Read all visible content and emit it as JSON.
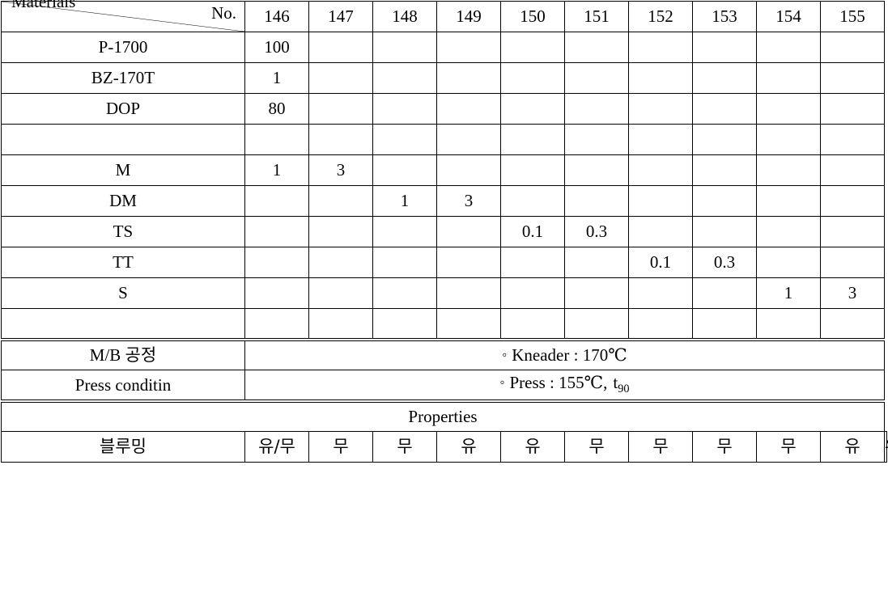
{
  "table": {
    "header": {
      "no_label": "No.",
      "materials_label": "Materials",
      "columns": [
        "146",
        "147",
        "148",
        "149",
        "150",
        "151",
        "152",
        "153",
        "154",
        "155"
      ]
    },
    "material_rows": [
      {
        "label": "P-1700",
        "values": [
          "100",
          "",
          "",
          "",
          "",
          "",
          "",
          "",
          "",
          ""
        ]
      },
      {
        "label": "BZ-170T",
        "values": [
          "1",
          "",
          "",
          "",
          "",
          "",
          "",
          "",
          "",
          ""
        ]
      },
      {
        "label": "DOP",
        "values": [
          "80",
          "",
          "",
          "",
          "",
          "",
          "",
          "",
          "",
          ""
        ]
      },
      {
        "label": "",
        "values": [
          "",
          "",
          "",
          "",
          "",
          "",
          "",
          "",
          "",
          ""
        ]
      },
      {
        "label": "M",
        "values": [
          "1",
          "3",
          "",
          "",
          "",
          "",
          "",
          "",
          "",
          ""
        ]
      },
      {
        "label": "DM",
        "values": [
          "",
          "",
          "1",
          "3",
          "",
          "",
          "",
          "",
          "",
          ""
        ]
      },
      {
        "label": "TS",
        "values": [
          "",
          "",
          "",
          "",
          "0.1",
          "0.3",
          "",
          "",
          "",
          ""
        ]
      },
      {
        "label": "TT",
        "values": [
          "",
          "",
          "",
          "",
          "",
          "",
          "0.1",
          "0.3",
          "",
          ""
        ]
      },
      {
        "label": "S",
        "values": [
          "",
          "",
          "",
          "",
          "",
          "",
          "",
          "",
          "1",
          "3"
        ]
      },
      {
        "label": "",
        "values": [
          "",
          "",
          "",
          "",
          "",
          "",
          "",
          "",
          "",
          ""
        ]
      }
    ],
    "process_rows": [
      {
        "label": "M/B 공정",
        "bullet": "◦",
        "value": "Kneader : 170℃"
      },
      {
        "label": "Press  conditin",
        "bullet": "◦",
        "value": "Press : 155℃,"
      }
    ],
    "press_subscript_base": "t",
    "press_subscript": "90",
    "properties": {
      "title": "Properties",
      "row_label": "블루밍",
      "row_sublabel": "유/무",
      "values": [
        "무",
        "무",
        "유",
        "유",
        "무",
        "무",
        "무",
        "무",
        "유",
        "유"
      ]
    }
  },
  "colors": {
    "border": "#000000",
    "background": "#ffffff",
    "text": "#000000"
  }
}
